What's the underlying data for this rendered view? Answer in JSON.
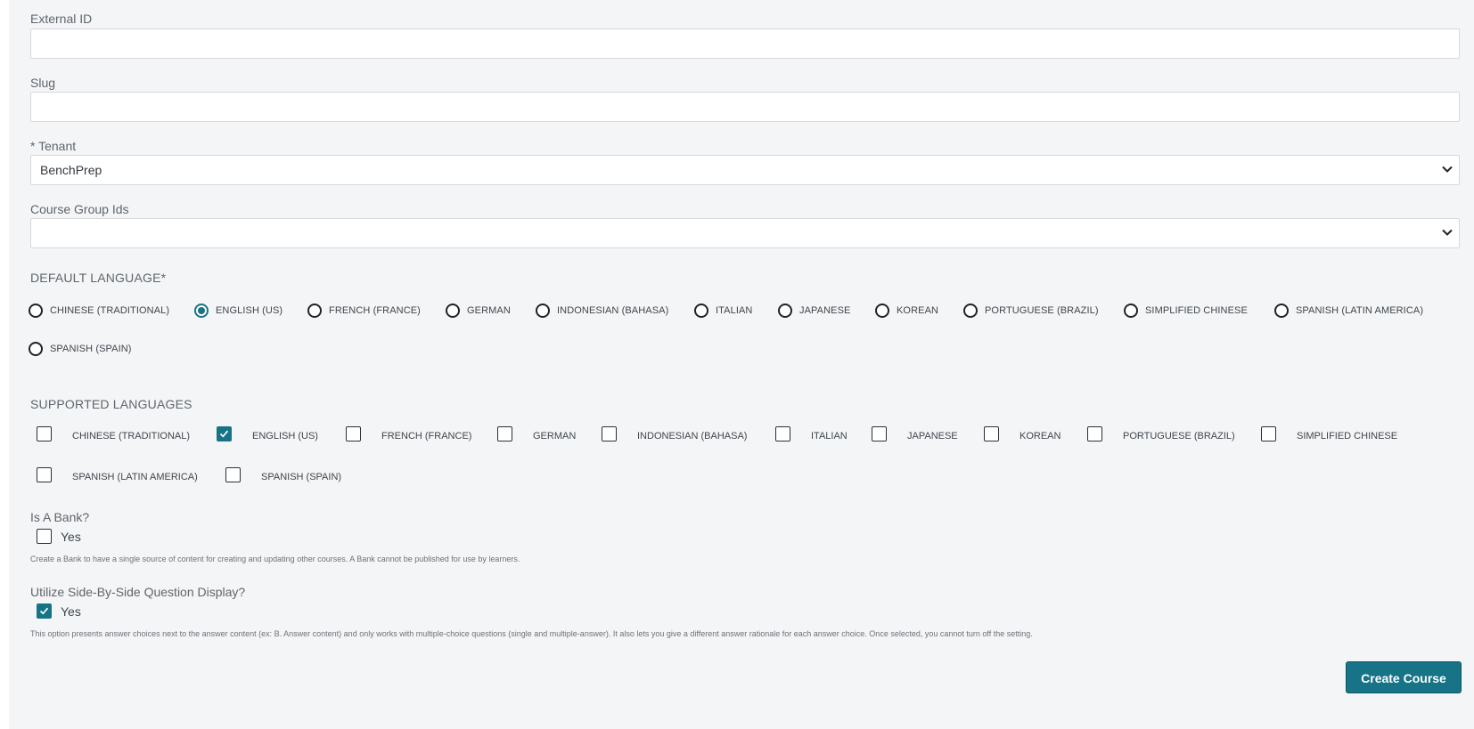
{
  "form": {
    "external_id": {
      "label": "External ID",
      "value": ""
    },
    "slug": {
      "label": "Slug",
      "value": ""
    },
    "tenant": {
      "required_mark": "*",
      "label": "Tenant",
      "value": "BenchPrep"
    },
    "course_group_ids": {
      "label": "Course Group Ids",
      "value": ""
    }
  },
  "default_language": {
    "title": "DEFAULT LANGUAGE*",
    "selected": "ENGLISH (US)",
    "options": [
      "CHINESE (TRADITIONAL)",
      "ENGLISH (US)",
      "FRENCH (FRANCE)",
      "GERMAN",
      "INDONESIAN (BAHASA)",
      "ITALIAN",
      "JAPANESE",
      "KOREAN",
      "PORTUGUESE (BRAZIL)",
      "SIMPLIFIED CHINESE",
      "SPANISH (LATIN AMERICA)",
      "SPANISH (SPAIN)"
    ]
  },
  "supported_languages": {
    "title": "SUPPORTED LANGUAGES",
    "checked": [
      "ENGLISH (US)"
    ],
    "options": [
      "CHINESE (TRADITIONAL)",
      "ENGLISH (US)",
      "FRENCH (FRANCE)",
      "GERMAN",
      "INDONESIAN (BAHASA)",
      "ITALIAN",
      "JAPANESE",
      "KOREAN",
      "PORTUGUESE (BRAZIL)",
      "SIMPLIFIED CHINESE",
      "SPANISH (LATIN AMERICA)",
      "SPANISH (SPAIN)"
    ]
  },
  "is_bank": {
    "label": "Is A Bank?",
    "option": "Yes",
    "checked": false,
    "help": "Create a Bank to have a single source of content for creating and updating other courses. A Bank cannot be published for use by learners."
  },
  "side_by_side": {
    "label": "Utilize Side-By-Side Question Display?",
    "option": "Yes",
    "checked": true,
    "help": "This option presents answer choices next to the answer content (ex: B. Answer content) and only works with multiple-choice questions (single and multiple-answer). It also lets you give a different answer rationale for each answer choice. Once selected, you cannot turn off the setting."
  },
  "actions": {
    "create_label": "Create Course"
  },
  "colors": {
    "accent": "#177386",
    "panel_bg": "#f4f5f6"
  },
  "icons": {
    "select_chevron": "chevron-down-icon",
    "checkmark": "checkmark-icon"
  }
}
